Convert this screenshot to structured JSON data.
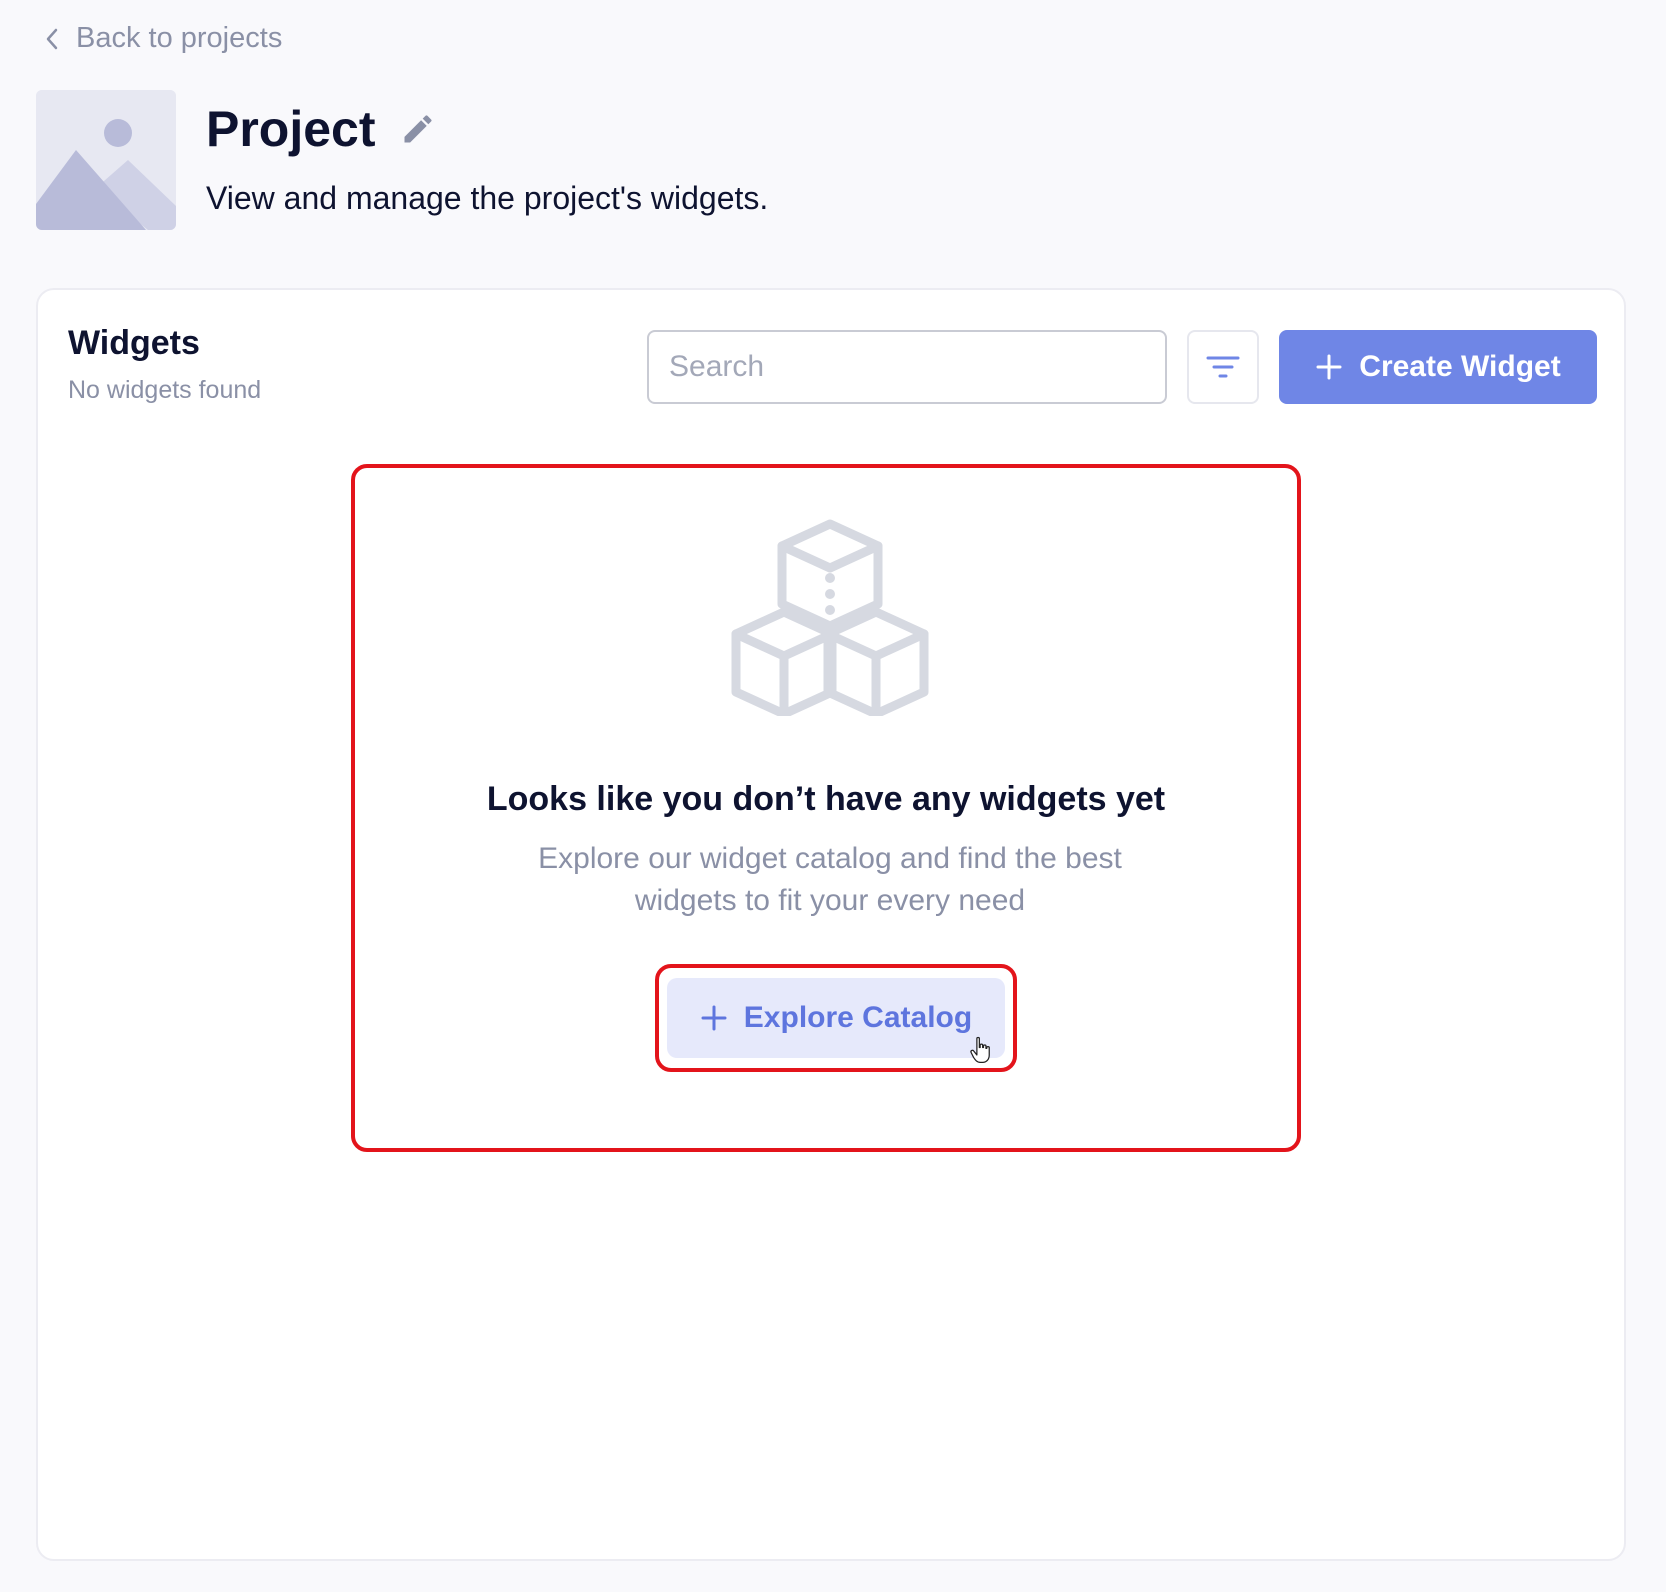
{
  "nav": {
    "back_label": "Back to projects"
  },
  "project": {
    "title": "Project",
    "subtitle": "View and manage the project's widgets."
  },
  "widgets": {
    "heading": "Widgets",
    "count_text": "No widgets found",
    "search_placeholder": "Search",
    "create_label": "Create Widget"
  },
  "empty_state": {
    "title": "Looks like you don’t have any widgets yet",
    "description": "Explore our widget catalog and find the best widgets to fit your every need",
    "button_label": "Explore Catalog"
  },
  "icons": {
    "back": "chevron-left-icon",
    "edit": "pencil-icon",
    "filter": "filter-icon",
    "plus": "plus-icon",
    "placeholder": "image-placeholder-icon",
    "cubes": "cubes-icon",
    "cursor": "hand-pointer-icon"
  },
  "colors": {
    "primary": "#6f86e6",
    "primary_light": "#e6e9fb",
    "highlight": "#e3141b",
    "muted_text": "#8a90a6",
    "heading_text": "#0e1330"
  }
}
